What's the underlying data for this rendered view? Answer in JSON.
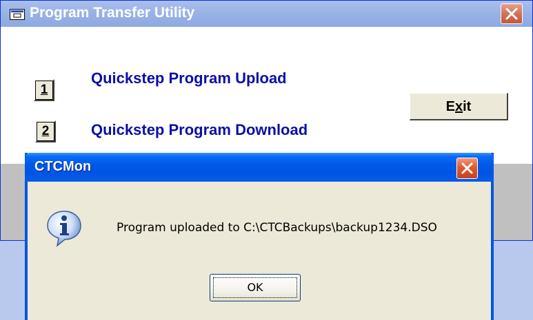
{
  "main_window": {
    "title": "Program Transfer Utility",
    "buttons": [
      {
        "key": "1",
        "label": "Quickstep Program Upload"
      },
      {
        "key": "2",
        "label": "Quickstep Program Download"
      }
    ],
    "exit_button": {
      "before": "E",
      "underlined": "x",
      "after": "it"
    },
    "app_icon": "window-app-icon",
    "close_icon": "close-icon"
  },
  "dialog": {
    "title": "CTCMon",
    "message": "Program uploaded to C:\\CTCBackups\\backup1234.DSO",
    "ok_label": "OK",
    "icon": "info-icon",
    "close_icon": "close-icon"
  },
  "colors": {
    "desktop": "#b9c9ee",
    "inactive_titlebar": "#98b2e6",
    "active_titlebar": "#0054e3",
    "link_blue": "#0a10a6",
    "dialog_face": "#ece9d8",
    "close_red": "#e15a32"
  }
}
